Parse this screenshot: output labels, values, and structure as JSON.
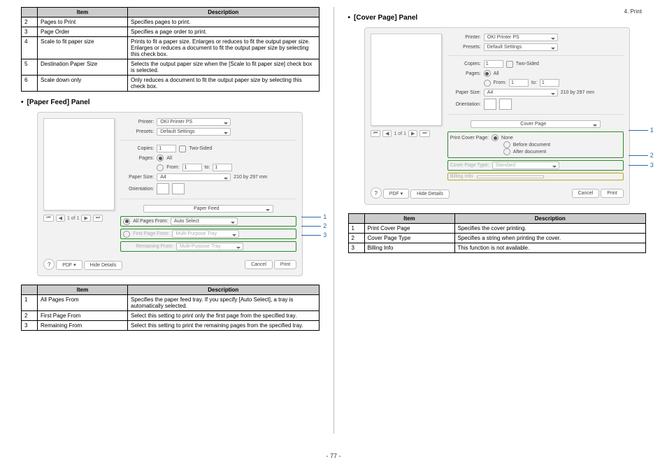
{
  "header": {
    "section": "4. Print"
  },
  "page_number": "- 77 -",
  "table1": {
    "headers": [
      "Item",
      "Description"
    ],
    "rows": [
      {
        "n": "2",
        "item": "Pages to Print",
        "desc": "Specifies pages to print."
      },
      {
        "n": "3",
        "item": "Page Order",
        "desc": "Specifies a page order to print."
      },
      {
        "n": "4",
        "item": "Scale to fit paper size",
        "desc": "Prints to fit a paper size. Enlarges or reduces to fit the output paper size. Enlarges or reduces a document to fit the output paper size by selecting this check box."
      },
      {
        "n": "5",
        "item": "Destination Paper Size",
        "desc": "Selects the output paper size when the [Scale to fit paper size] check box is selected."
      },
      {
        "n": "6",
        "item": "Scale down only",
        "desc": "Only reduces a document to fit the output paper size by selecting this check box."
      }
    ]
  },
  "section_paper_feed": "[Paper Feed] Panel",
  "section_cover_page": "[Cover Page] Panel",
  "dialog_common": {
    "printer_label": "Printer:",
    "printer_value": "OKI Printer PS",
    "presets_label": "Presets:",
    "presets_value": "Default Settings",
    "copies_label": "Copies:",
    "copies_value": "1",
    "twosided_label": "Two-Sided",
    "pages_label": "Pages:",
    "pages_all": "All",
    "pages_from": "From:",
    "pages_from_val": "1",
    "pages_to": "to:",
    "pages_to_val": "1",
    "papersize_label": "Paper Size:",
    "papersize_value": "A4",
    "papersize_dim": "210 by 297 mm",
    "orientation_label": "Orientation:",
    "pagebar_text": "1 of 1",
    "help": "?",
    "pdf": "PDF",
    "hide_details": "Hide Details",
    "cancel": "Cancel",
    "print": "Print"
  },
  "paper_feed_panel": {
    "panel_name": "Paper Feed",
    "opt1_label": "All Pages From:",
    "opt1_value": "Auto Select",
    "opt2_label": "First Page From:",
    "opt2_value": "Multi-Purpose Tray",
    "opt3_label": "Remaining From:",
    "opt3_value": "Multi-Purpose Tray",
    "callouts": [
      "1",
      "2",
      "3"
    ]
  },
  "cover_page_panel": {
    "panel_name": "Cover Page",
    "print_cover_label": "Print Cover Page:",
    "opt_none": "None",
    "opt_before": "Before document",
    "opt_after": "After document",
    "type_label": "Cover Page Type:",
    "type_value": "Standard",
    "billing_label": "Billing Info:",
    "billing_value": "",
    "callouts": [
      "1",
      "2",
      "3"
    ]
  },
  "table2": {
    "headers": [
      "Item",
      "Description"
    ],
    "rows": [
      {
        "n": "1",
        "item": "All Pages From",
        "desc": "Specifies the paper feed tray. If you specify [Auto Select], a tray is automatically selected."
      },
      {
        "n": "2",
        "item": "First Page From",
        "desc": "Select this setting to print only the first page from the specified tray."
      },
      {
        "n": "3",
        "item": "Remaining From",
        "desc": "Select this setting to print the remaining pages from the specified tray."
      }
    ]
  },
  "table3": {
    "headers": [
      "Item",
      "Description"
    ],
    "rows": [
      {
        "n": "1",
        "item": "Print Cover Page",
        "desc": "Specifies the cover printing."
      },
      {
        "n": "2",
        "item": "Cover Page Type",
        "desc": "Specifies a string when printing the cover."
      },
      {
        "n": "3",
        "item": "Billing Info",
        "desc": "This function is not available."
      }
    ]
  }
}
